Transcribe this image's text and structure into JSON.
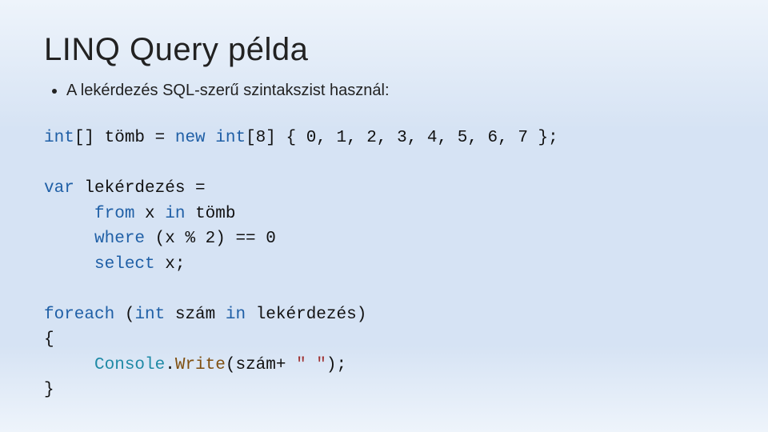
{
  "title": "LINQ Query példa",
  "bullet": "A lekérdezés SQL-szerű szintakszist használ:",
  "code": {
    "l1_a": "int",
    "l1_b": "[] tömb = ",
    "l1_c": "new",
    "l1_d": " ",
    "l1_e": "int",
    "l1_f": "[8] { 0, 1, 2, 3, 4, 5, 6, 7 };",
    "l2": "",
    "l3_a": "var",
    "l3_b": " lekérdezés =",
    "l4_a": "     ",
    "l4_b": "from",
    "l4_c": " x ",
    "l4_d": "in",
    "l4_e": " tömb",
    "l5_a": "     ",
    "l5_b": "where",
    "l5_c": " (x % 2) == 0",
    "l6_a": "     ",
    "l6_b": "select",
    "l6_c": " x;",
    "l7": "",
    "l8_a": "foreach",
    "l8_b": " (",
    "l8_c": "int",
    "l8_d": " szám ",
    "l8_e": "in",
    "l8_f": " lekérdezés)",
    "l9": "{",
    "l10_a": "     ",
    "l10_b": "Console",
    "l10_c": ".",
    "l10_d": "Write",
    "l10_e": "(szám+ ",
    "l10_f": "\" \"",
    "l10_g": ");",
    "l11": "}"
  }
}
